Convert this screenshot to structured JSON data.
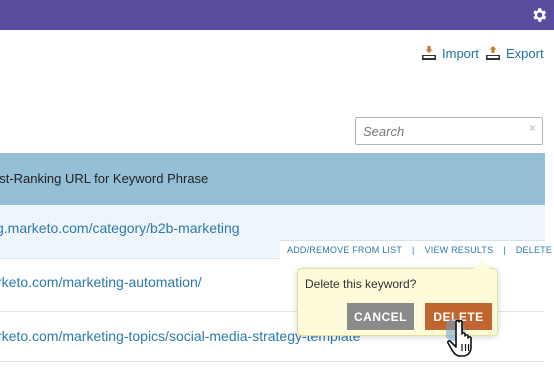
{
  "toolbar": {
    "import_label": "Import",
    "export_label": "Export"
  },
  "search": {
    "placeholder": "Search",
    "clear_glyph": "×"
  },
  "table": {
    "column_header": "est-Ranking URL for Keyword Phrase",
    "rows": [
      {
        "url": "g.marketo.com/category/b2b-marketing"
      },
      {
        "url": "rketo.com/marketing-automation/"
      },
      {
        "url": "rketo.com/marketing-topics/social-media-strategy-template"
      }
    ],
    "row_actions": {
      "add_remove": "ADD/REMOVE FROM LIST",
      "view_results": "VIEW RESULTS",
      "delete": "DELETE",
      "separator": "|"
    }
  },
  "confirm_popover": {
    "question": "Delete this keyword?",
    "cancel_label": "CANCEL",
    "delete_label": "DELETE"
  },
  "icons": {
    "settings": "gear-icon",
    "import": "import-icon",
    "export": "export-icon",
    "cursor": "hand-pointer-icon"
  },
  "colors": {
    "topbar": "#5a4b9f",
    "header": "#94bfd6",
    "link": "#2d79ad",
    "delete_button": "#c06530",
    "cancel_button": "#8a8a88",
    "popover_bg": "#fdfbd9"
  }
}
